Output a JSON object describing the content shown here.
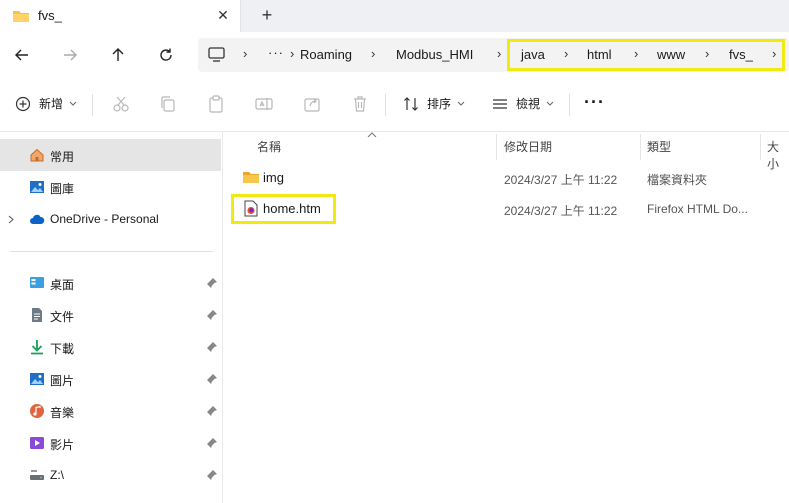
{
  "tab": {
    "title": "fvs_",
    "close": "✕",
    "new_tab": "+"
  },
  "breadcrumbs": [
    "Roaming",
    "Modbus_HMI",
    "java",
    "html",
    "www",
    "fvs_"
  ],
  "breadcrumb_separator": "›",
  "ellipsis": "···",
  "toolbar": {
    "new_label": "新增",
    "sort_label": "排序",
    "view_label": "檢視",
    "more": "···"
  },
  "sidebar": {
    "top": [
      {
        "label": "常用",
        "icon": "home-icon",
        "selected": true
      },
      {
        "label": "圖庫",
        "icon": "gallery-icon"
      },
      {
        "label": "OneDrive - Personal",
        "icon": "cloud-icon"
      }
    ],
    "quick": [
      {
        "label": "桌面",
        "icon": "desktop-icon"
      },
      {
        "label": "文件",
        "icon": "documents-icon"
      },
      {
        "label": "下載",
        "icon": "download-icon"
      },
      {
        "label": "圖片",
        "icon": "pictures-icon"
      },
      {
        "label": "音樂",
        "icon": "music-icon"
      },
      {
        "label": "影片",
        "icon": "videos-icon"
      },
      {
        "label": "Z:\\",
        "icon": "drive-icon"
      }
    ]
  },
  "columns": {
    "name": "名稱",
    "modified": "修改日期",
    "type": "類型",
    "size": "大小"
  },
  "files": [
    {
      "name": "img",
      "modified": "2024/3/27 上午 11:22",
      "type": "檔案資料夾",
      "icon": "folder-icon"
    },
    {
      "name": "home.htm",
      "modified": "2024/3/27 上午 11:22",
      "type": "Firefox HTML Do...",
      "icon": "firefox-html-icon"
    }
  ],
  "colors": {
    "highlight": "#f0ea10",
    "accent": "#0067c0",
    "folder": "#f4c34a"
  }
}
